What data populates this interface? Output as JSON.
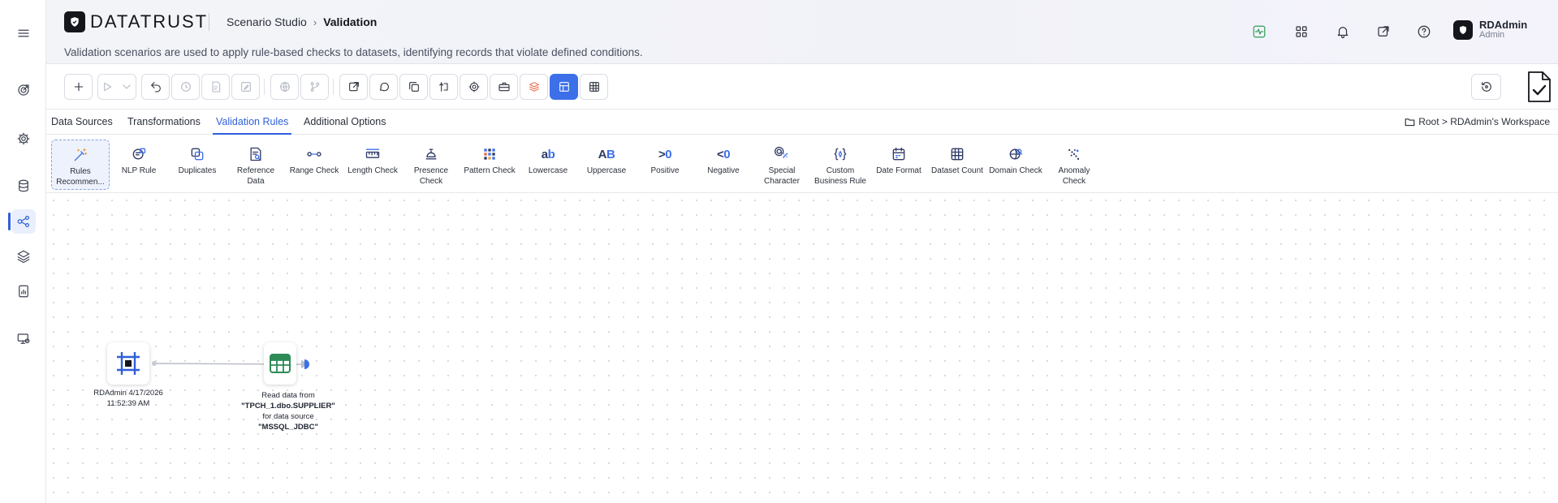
{
  "app": {
    "logo_text": "DATATRUST",
    "breadcrumb": {
      "parent": "Scenario Studio",
      "current": "Validation"
    },
    "description": "Validation scenarios are used to apply rule-based checks to datasets, identifying records that violate defined conditions.",
    "user": {
      "name": "RDAdmin",
      "role": "Admin"
    }
  },
  "tabs": [
    {
      "label": "Data Sources"
    },
    {
      "label": "Transformations"
    },
    {
      "label": "Validation Rules",
      "active": true
    },
    {
      "label": "Additional Options"
    }
  ],
  "workspace_path": "Root > RDAdmin's Workspace",
  "palette": [
    {
      "label": "Rules Recommen...",
      "icon": "magic-wand-icon"
    },
    {
      "label": "NLP Rule",
      "icon": "brain-icon"
    },
    {
      "label": "Duplicates",
      "icon": "duplicate-icon"
    },
    {
      "label": "Reference Data",
      "icon": "reference-doc-icon"
    },
    {
      "label": "Range Check",
      "icon": "range-icon"
    },
    {
      "label": "Length Check",
      "icon": "ruler-icon"
    },
    {
      "label": "Presence Check",
      "icon": "presence-icon"
    },
    {
      "label": "Pattern Check",
      "icon": "pattern-grid-icon"
    },
    {
      "label": "Lowercase",
      "icon": "lowercase-icon",
      "glyph": "ab"
    },
    {
      "label": "Uppercase",
      "icon": "uppercase-icon",
      "glyph": "AB"
    },
    {
      "label": "Positive",
      "icon": "greater-than-zero-icon",
      "glyph": ">0"
    },
    {
      "label": "Negative",
      "icon": "less-than-zero-icon",
      "glyph": "<0"
    },
    {
      "label": "Special Character",
      "icon": "special-char-icon"
    },
    {
      "label": "Custom Business Rule",
      "icon": "custom-rule-icon"
    },
    {
      "label": "Date Format",
      "icon": "calendar-icon"
    },
    {
      "label": "Dataset Count",
      "icon": "dataset-grid-icon"
    },
    {
      "label": "Domain Check",
      "icon": "globe-search-icon"
    },
    {
      "label": "Anomaly Check",
      "icon": "scatter-icon"
    }
  ],
  "canvas": {
    "nodes": [
      {
        "id": "start",
        "label": "RDAdmin 4/17/2026 11:52:39 AM",
        "icon": "start-node-icon"
      },
      {
        "id": "read",
        "label_prefix": "Read data from ",
        "table": "\"TPCH_1.dbo.SUPPLIER\"",
        "label_mid": " for data source ",
        "source": "\"MSSQL_JDBC\"",
        "icon": "table-node-icon"
      }
    ]
  },
  "colors": {
    "accent": "#3d6fe8",
    "brand_dark": "#14161c",
    "node_green": "#2e8b57",
    "start_node": "#2f5fd9"
  }
}
